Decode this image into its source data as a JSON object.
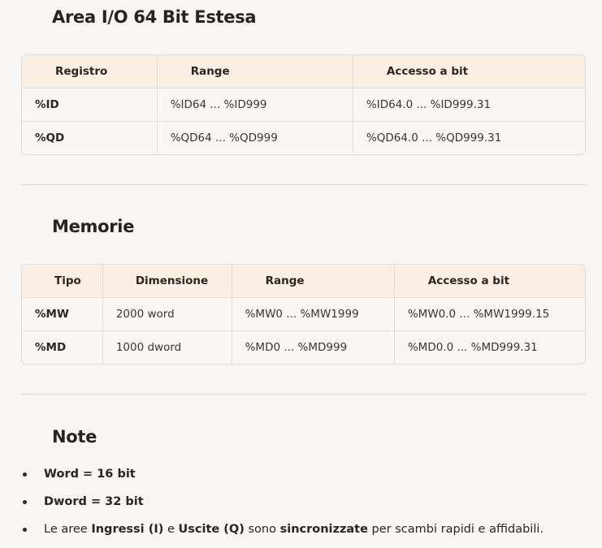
{
  "sections": {
    "io": {
      "title": "Area I/O 64 Bit Estesa",
      "headers": [
        "Registro",
        "Range",
        "Accesso a bit"
      ],
      "rows": [
        [
          "%ID",
          "%ID64 ... %ID999",
          "%ID64.0 ... %ID999.31"
        ],
        [
          "%QD",
          "%QD64 ... %QD999",
          "%QD64.0 ... %QD999.31"
        ]
      ]
    },
    "memory": {
      "title": "Memorie",
      "headers": [
        "Tipo",
        "Dimensione",
        "Range",
        "Accesso a bit"
      ],
      "rows": [
        [
          "%MW",
          "2000 word",
          "%MW0 ... %MW1999",
          "%MW0.0 ... %MW1999.15"
        ],
        [
          "%MD",
          "1000 dword",
          "%MD0 ... %MD999",
          "%MD0.0 ... %MD999.31"
        ]
      ]
    },
    "notes": {
      "title": "Note",
      "items": {
        "word": "Word = 16 bit",
        "dword": "Dword = 32 bit",
        "sync": {
          "p1": "Le aree ",
          "b1": "Ingressi (I)",
          "p2": " e ",
          "b2": "Uscite (Q)",
          "p3": " sono ",
          "b3": "sincronizzate",
          "p4": " per scambi rapidi e affidabili."
        }
      }
    }
  }
}
